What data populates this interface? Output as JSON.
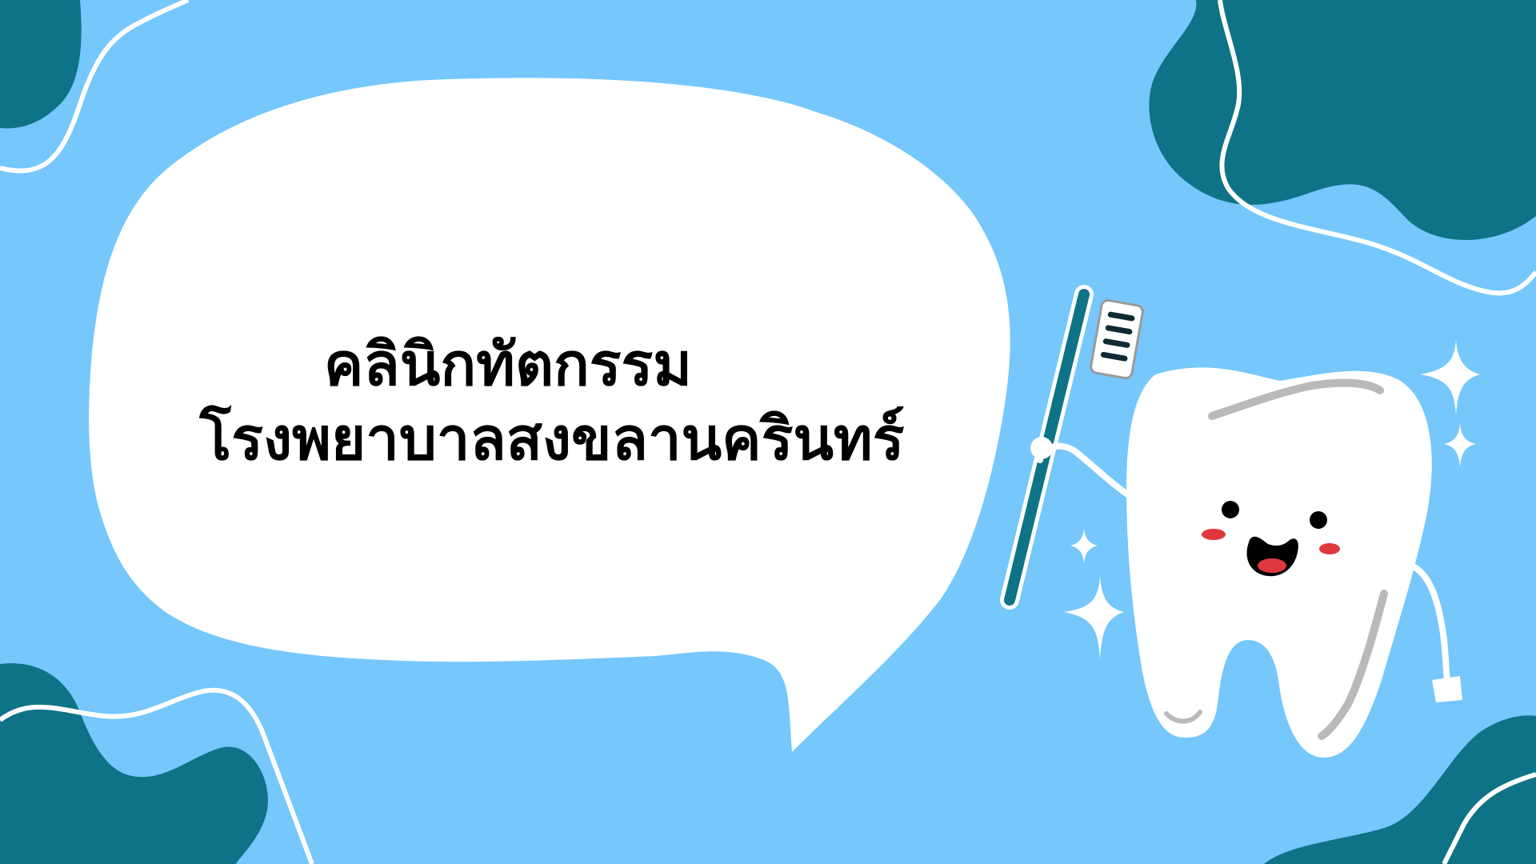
{
  "slide": {
    "title_line1": "คลินิกทัตกรรม",
    "title_line2": "โรงพยาบาลสงขลานครินทร์"
  },
  "colors": {
    "background": "#75c7fc",
    "blob": "#0f7387",
    "bubble": "#ffffff",
    "text": "#000000",
    "tooth_shadow": "#b9b9b9",
    "cheek": "#e0373f"
  },
  "icons": {
    "corner_blobs": "decorative-blob",
    "speech_bubble": "speech-bubble",
    "mascot": "smiling-tooth-with-toothbrush",
    "sparkles": "sparkle"
  }
}
